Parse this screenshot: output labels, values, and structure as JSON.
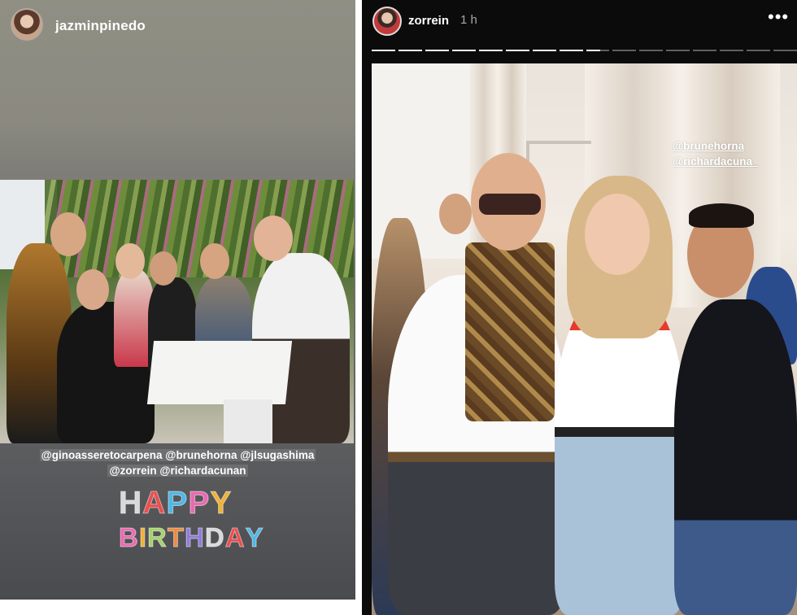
{
  "left_story": {
    "username": "jazminpinedo",
    "mentions_line1": "@ginoasseretocarpena @brunehorna @jlsugashima",
    "mentions_line2": "@zorrein @richardacunan",
    "sticker_line1": [
      "H",
      "A",
      "P",
      "P",
      "Y"
    ],
    "sticker_line2": [
      "B",
      "I",
      "R",
      "T",
      "H",
      "D",
      "A",
      "Y"
    ],
    "sticker_colors": [
      "#d9d9d9",
      "#e94e4e",
      "#4fb7e6",
      "#e96ab0",
      "#f2b134",
      "#a6d36b",
      "#f08a3c",
      "#8f7cd9"
    ]
  },
  "right_story": {
    "username": "zorrein",
    "time": "1 h",
    "more_icon": "more-horizontal-icon",
    "progress": {
      "segments": 16,
      "done": 8,
      "active_fraction": 0.6
    },
    "tags": [
      "@brunehorna",
      "@richardacuna_"
    ]
  }
}
